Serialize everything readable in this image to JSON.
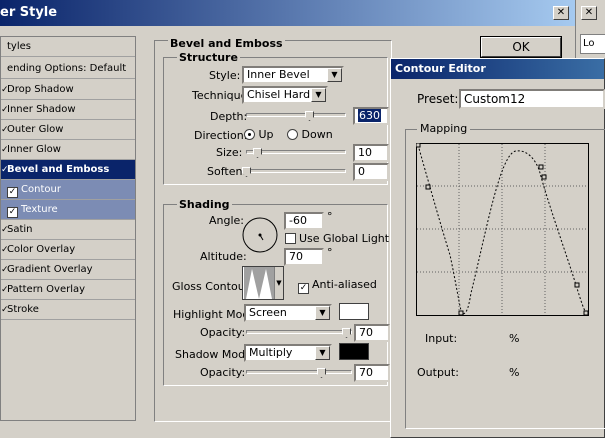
{
  "window": {
    "title": "er Style"
  },
  "right_strip": {
    "label": "Lo"
  },
  "styles_list": {
    "header": "tyles",
    "blending_options": "ending Options: Default",
    "items": [
      {
        "label": "Drop Shadow",
        "checked": true
      },
      {
        "label": "Inner Shadow",
        "checked": true
      },
      {
        "label": "Outer Glow",
        "checked": true
      },
      {
        "label": "Inner Glow",
        "checked": true
      },
      {
        "label": "Bevel and Emboss",
        "checked": true,
        "selected": true
      },
      {
        "label": "Contour",
        "checked": true,
        "sub": true
      },
      {
        "label": "Texture",
        "checked": true,
        "sub": true
      },
      {
        "label": "Satin",
        "checked": true
      },
      {
        "label": "Color Overlay",
        "checked": true
      },
      {
        "label": "Gradient Overlay",
        "checked": true
      },
      {
        "label": "Pattern Overlay",
        "checked": true
      },
      {
        "label": "Stroke",
        "checked": true
      }
    ]
  },
  "bevel": {
    "title": "Bevel and Emboss",
    "structure": {
      "title": "Structure",
      "style_label": "Style:",
      "style_value": "Inner Bevel",
      "technique_label": "Technique:",
      "technique_value": "Chisel Hard",
      "depth_label": "Depth:",
      "depth_value": "630",
      "direction_label": "Direction:",
      "dir_up": "Up",
      "dir_down": "Down",
      "size_label": "Size:",
      "size_value": "10",
      "soften_label": "Soften:",
      "soften_value": "0"
    },
    "shading": {
      "title": "Shading",
      "angle_label": "Angle:",
      "angle_value": "-60",
      "degree": "°",
      "global_light": "Use Global Light",
      "altitude_label": "Altitude:",
      "altitude_value": "70",
      "gloss_label": "Gloss Contour:",
      "anti_aliased": "Anti-aliased",
      "highlight_label": "Highlight Mode:",
      "highlight_value": "Screen",
      "highlight_color": "#ffffff",
      "opacity_label": "Opacity:",
      "highlight_opacity": "70",
      "shadow_label": "Shadow Mode:",
      "shadow_value": "Multiply",
      "shadow_color": "#000000",
      "shadow_opacity": "70"
    }
  },
  "ok_label": "OK",
  "contour_editor": {
    "title": "Contour Editor",
    "preset_label": "Preset:",
    "preset_value": "Custom12",
    "mapping_label": "Mapping",
    "input_label": "Input:",
    "input_unit": "%",
    "output_label": "Output:",
    "output_unit": "%"
  }
}
